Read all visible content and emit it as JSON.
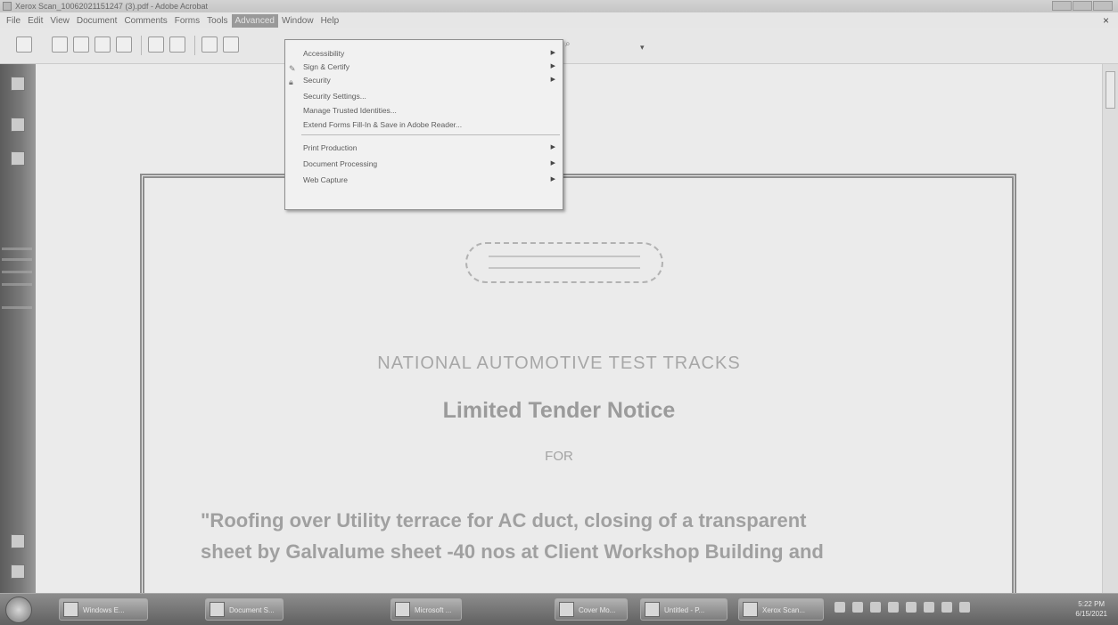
{
  "window": {
    "title": "Xerox Scan_10062021151247 (3).pdf - Adobe Acrobat"
  },
  "menubar": {
    "items": [
      "File",
      "Edit",
      "View",
      "Document",
      "Comments",
      "Forms",
      "Tools",
      "Advanced",
      "Window",
      "Help"
    ],
    "active": "Advanced"
  },
  "advanced_menu": {
    "items": [
      {
        "label": "Accessibility",
        "submenu": true
      },
      {
        "label": "Sign & Certify",
        "submenu": true,
        "icon": "pen-icon"
      },
      {
        "label": "Security",
        "submenu": true,
        "icon": "lock-icon"
      },
      {
        "label": "Security Settings...",
        "submenu": false
      },
      {
        "label": "Manage Trusted Identities...",
        "submenu": false
      },
      {
        "label": "Extend Forms Fill-In & Save in Adobe Reader...",
        "submenu": false
      },
      {
        "label": "Print Production",
        "submenu": true
      },
      {
        "label": "Document Processing",
        "submenu": true
      },
      {
        "label": "Web Capture",
        "submenu": true
      }
    ]
  },
  "document": {
    "organization": "NATIONAL AUTOMOTIVE TEST TRACKS",
    "title": "Limited Tender Notice",
    "for": "FOR",
    "body_line1": "\"Roofing over Utility terrace for AC duct, closing of a transparent",
    "body_line2": "sheet by Galvalume sheet -40 nos at Client Workshop Building and"
  },
  "taskbar": {
    "buttons": [
      "Windows E...",
      "Document S...",
      "Microsoft ...",
      "Cover Mo...",
      "Untitled - P...",
      "Xerox Scan..."
    ]
  },
  "clock": {
    "time": "5:22 PM",
    "date": "6/15/2021"
  },
  "colors": {
    "menu_highlight": "#9a9a9a",
    "taskbar": "#6f6f6f"
  }
}
